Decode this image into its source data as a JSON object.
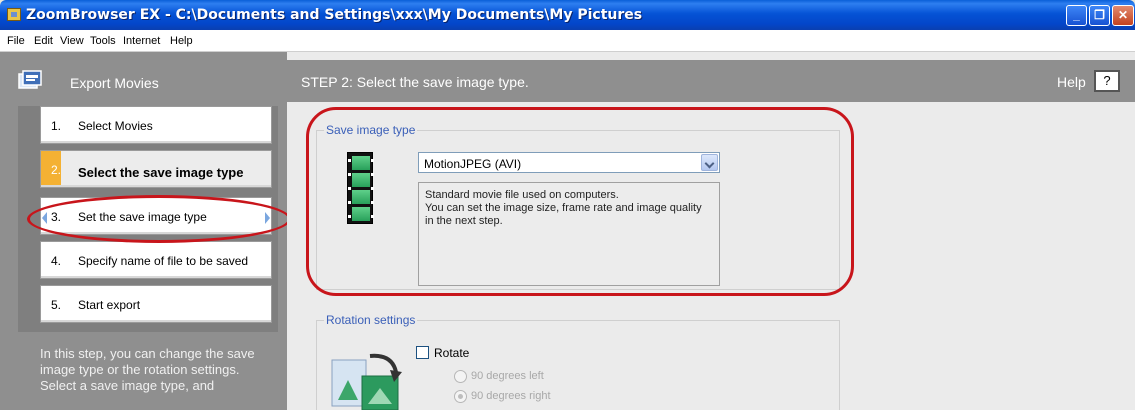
{
  "window": {
    "title": "ZoomBrowser EX  -  C:\\Documents and Settings\\xxx\\My Documents\\My Pictures",
    "minimize": "_",
    "maximize": "❐",
    "close": "✕"
  },
  "menubar": {
    "items": [
      "File",
      "Edit",
      "View",
      "Tools",
      "Internet",
      "Help"
    ]
  },
  "sidebar": {
    "title": "Export Movies",
    "steps": [
      {
        "num": "1.",
        "label": "Select Movies"
      },
      {
        "num": "2.",
        "label": "Select the save image type"
      },
      {
        "num": "3.",
        "label": "Set the save image type"
      },
      {
        "num": "4.",
        "label": "Specify name of file to be saved"
      },
      {
        "num": "5.",
        "label": "Start export"
      }
    ],
    "description": "In this step, you can change the save image type or the rotation settings.\n Select a save image type, and"
  },
  "main": {
    "step_title": "STEP 2: Select the save image type.",
    "help_label": "Help",
    "help_button": "?",
    "save_type": {
      "legend": "Save image type",
      "selected": "MotionJPEG (AVI)",
      "description_lines": [
        "Standard movie file used on computers.",
        "You can set the image size, frame rate and image quality",
        "in the next step."
      ]
    },
    "rotation": {
      "legend": "Rotation settings",
      "rotate_label": "Rotate",
      "options": [
        "90 degrees left",
        "90 degrees right"
      ]
    }
  },
  "colors": {
    "highlight_red": "#c8151b",
    "active_step": "#f4b133",
    "legend_blue": "#3a5fb8"
  }
}
